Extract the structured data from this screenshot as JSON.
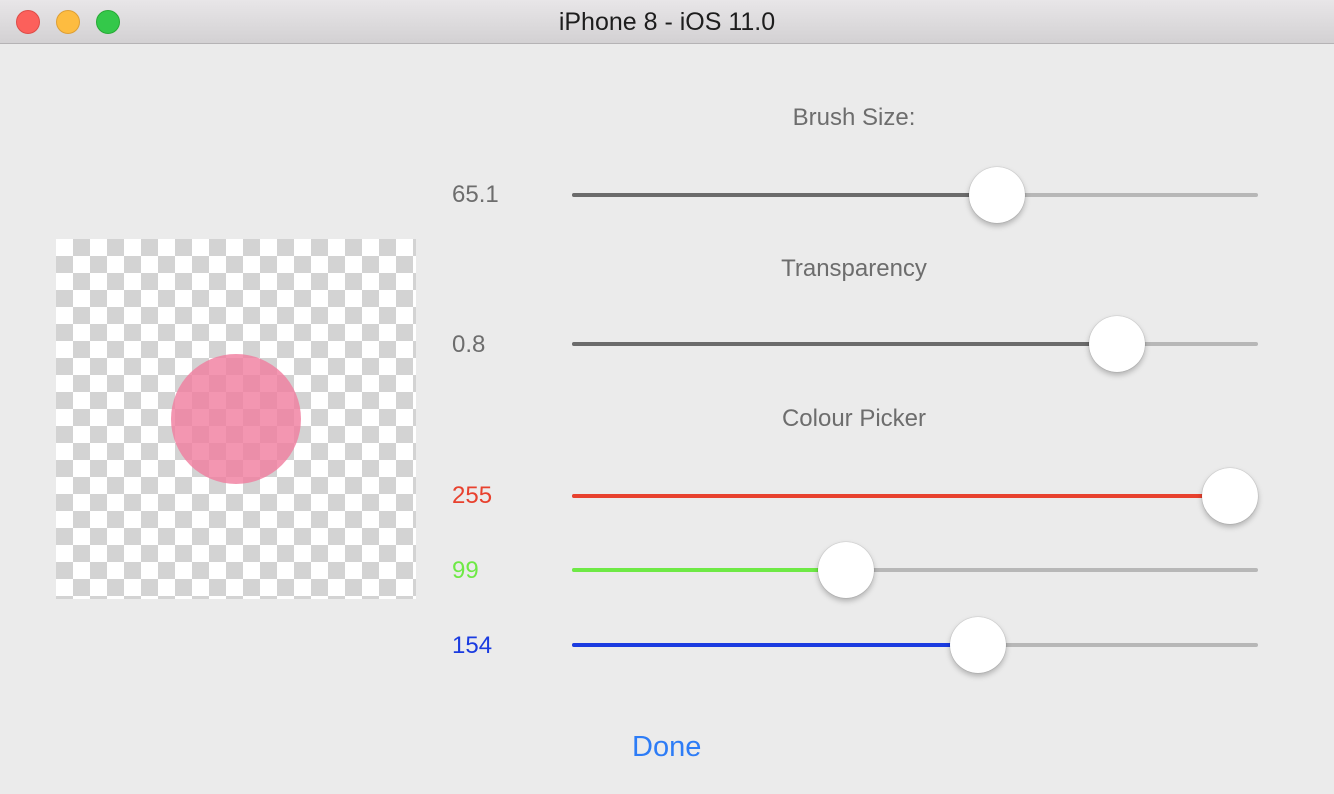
{
  "window": {
    "title": "iPhone 8 - iOS 11.0"
  },
  "preview": {
    "brush_color": "#f07fa0"
  },
  "brush_size": {
    "label": "Brush Size:",
    "value_text": "65.1",
    "fraction": 0.63,
    "fill_color": "#6b6b6b"
  },
  "transparency": {
    "label": "Transparency",
    "value_text": "0.8",
    "fraction": 0.82,
    "fill_color": "#6b6b6b"
  },
  "colour_picker": {
    "label": "Colour Picker",
    "red": {
      "value_text": "255",
      "fraction": 1.0,
      "color": "#e8412e"
    },
    "green": {
      "value_text": "99",
      "fraction": 0.39,
      "color": "#6ee945"
    },
    "blue": {
      "value_text": "154",
      "fraction": 0.6,
      "color": "#1a3be0"
    }
  },
  "done_label": "Done"
}
